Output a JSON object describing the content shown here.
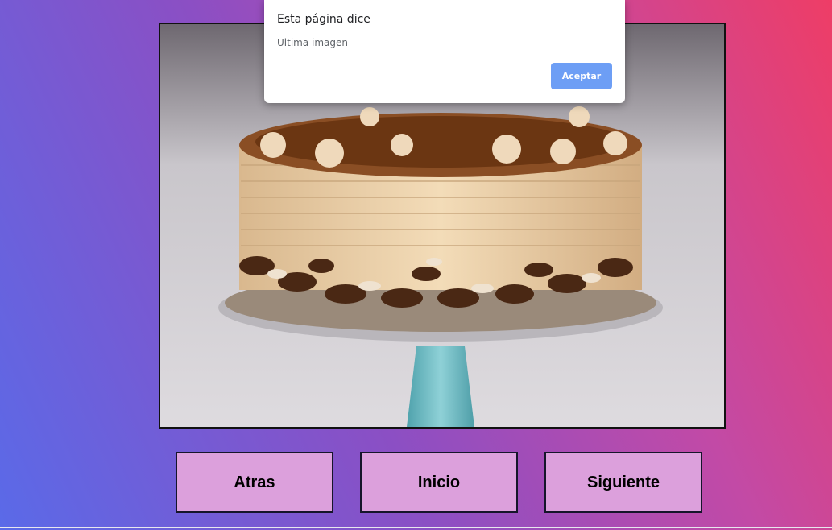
{
  "slideshow": {
    "image_description": "cake-photo",
    "buttons": {
      "back": "Atras",
      "home": "Inicio",
      "next": "Siguiente"
    }
  },
  "alert": {
    "title": "Esta página dice",
    "message": "Ultima imagen",
    "ok_label": "Aceptar"
  },
  "colors": {
    "button_bg": "#dca0dc",
    "alert_button": "#6d9ef5"
  }
}
